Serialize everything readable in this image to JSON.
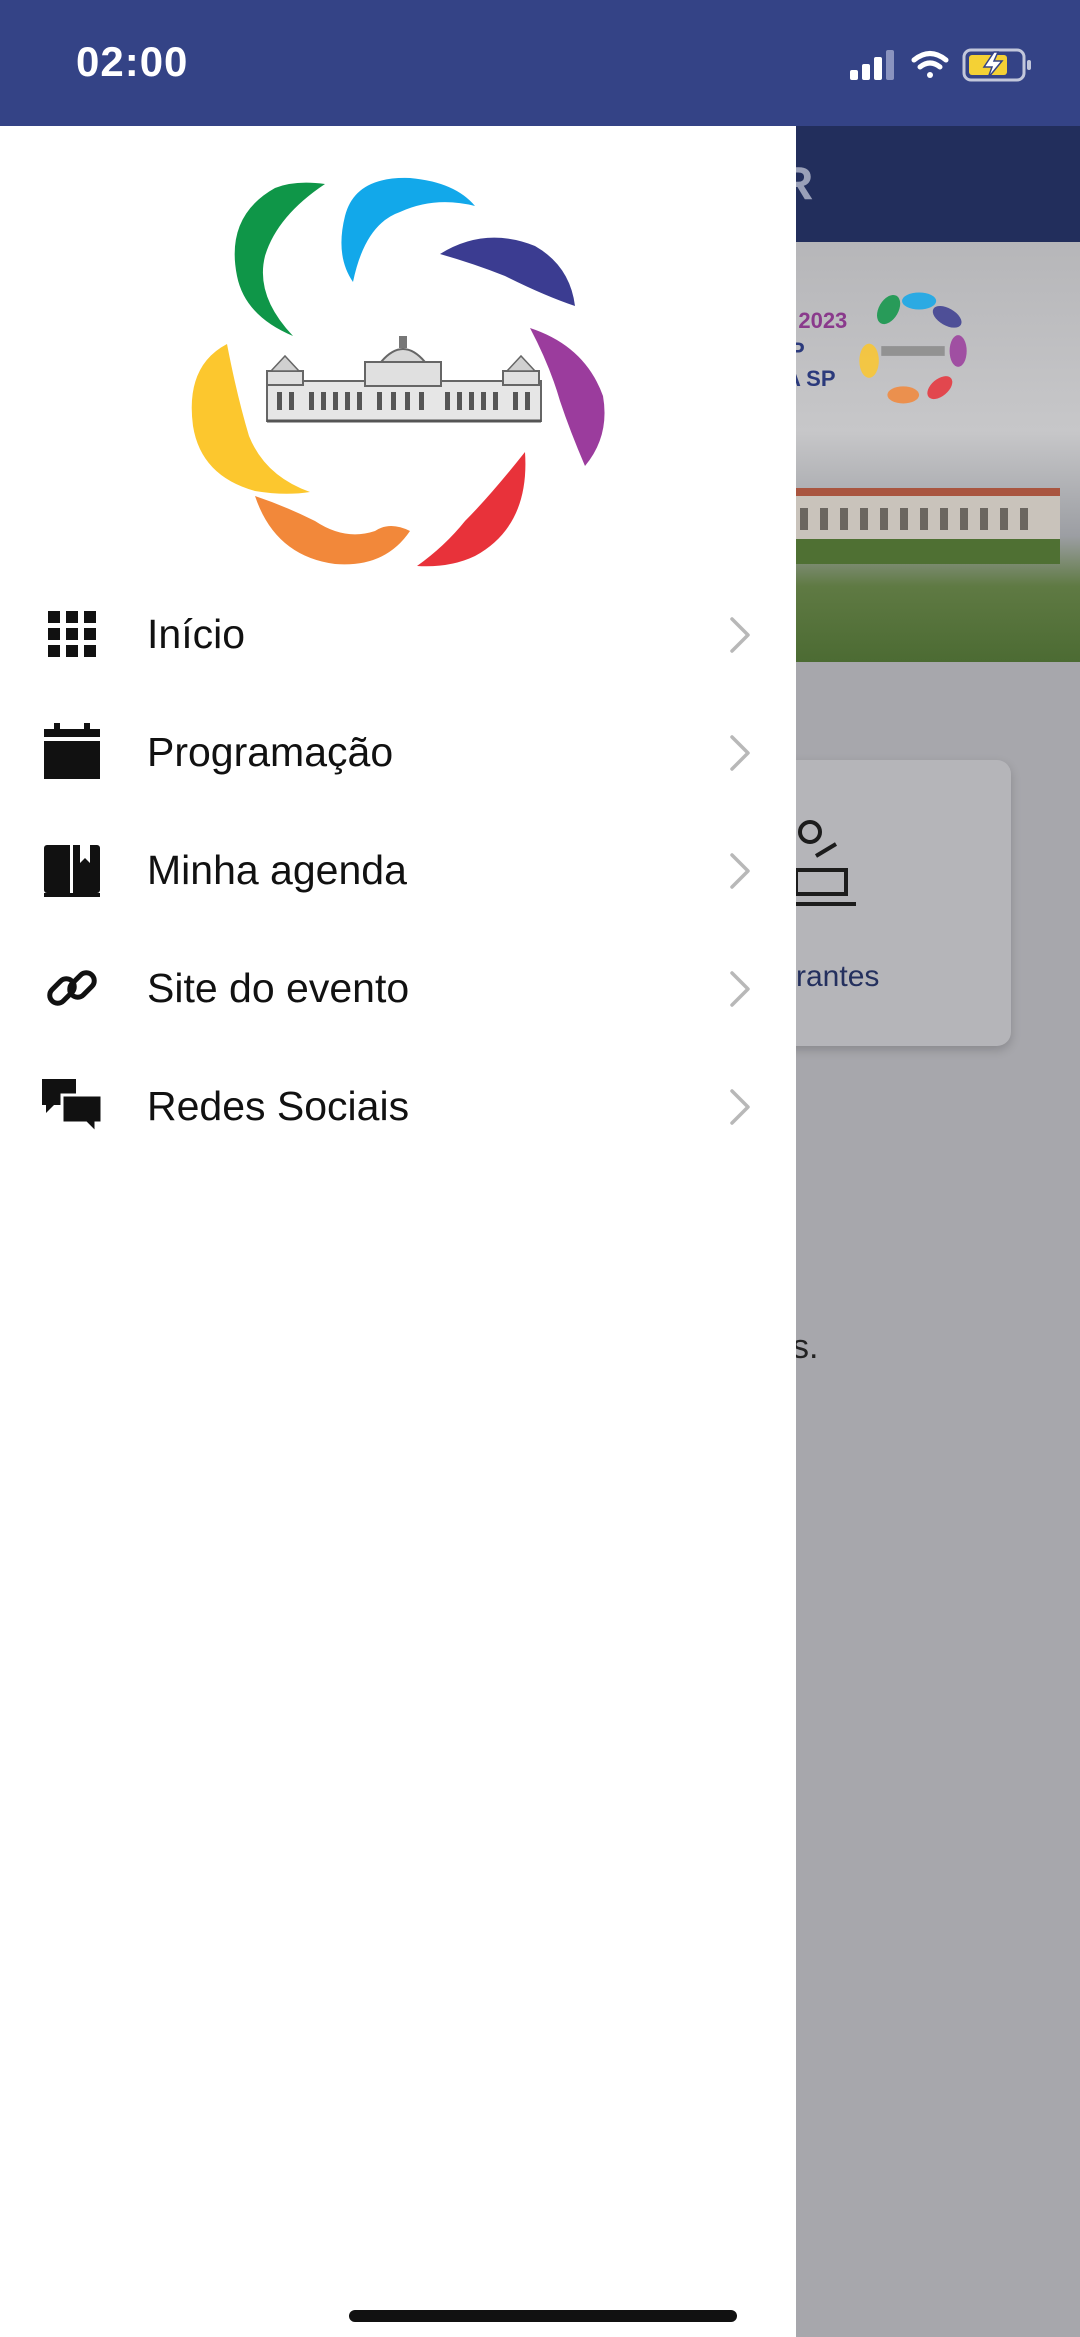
{
  "status_bar": {
    "time": "02:00",
    "icons": [
      "cellular-signal-icon",
      "wifi-icon",
      "battery-charging-icon"
    ],
    "background_color": "#344386"
  },
  "background_app": {
    "header_partial_text": "R",
    "banner": {
      "line1": "e 2023",
      "line2": "P",
      "line3": "A SP"
    },
    "card": {
      "label_partial": "rantes",
      "icon": "speaker-podium-icon"
    },
    "stray_text": "s."
  },
  "drawer": {
    "logo": "event-logo-flower-building",
    "menu": [
      {
        "label": "Início",
        "icon": "grid-icon"
      },
      {
        "label": "Programação",
        "icon": "calendar-icon"
      },
      {
        "label": "Minha agenda",
        "icon": "book-bookmark-icon"
      },
      {
        "label": "Site do evento",
        "icon": "link-icon"
      },
      {
        "label": "Redes Sociais",
        "icon": "chat-bubbles-icon"
      }
    ]
  },
  "colors": {
    "petal_green": "#0f9648",
    "petal_blue": "#12a8ea",
    "petal_indigo": "#3b3c91",
    "petal_purple": "#9b3c9d",
    "petal_red": "#e8323a",
    "petal_orange": "#f2883a",
    "petal_yellow": "#fcc72e"
  }
}
